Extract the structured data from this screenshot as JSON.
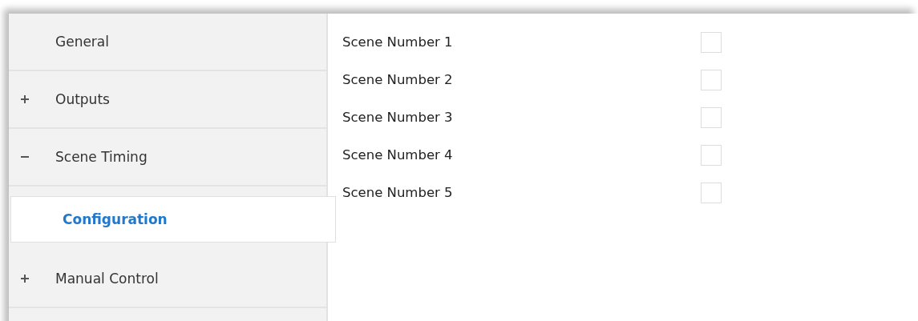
{
  "sidebar": {
    "items": [
      {
        "kind": "page",
        "label": "General",
        "selected": false
      },
      {
        "kind": "group",
        "label": "Outputs",
        "expanded": false,
        "selected": false
      },
      {
        "kind": "group",
        "label": "Scene Timing",
        "expanded": true,
        "selected": false,
        "children": [
          {
            "label": "Configuration",
            "selected": true
          }
        ]
      },
      {
        "kind": "group",
        "label": "Manual Control",
        "expanded": false,
        "selected": false
      }
    ]
  },
  "scenes": [
    {
      "label": "Scene Number 1",
      "checked": false
    },
    {
      "label": "Scene Number 2",
      "checked": false
    },
    {
      "label": "Scene Number 3",
      "checked": false
    },
    {
      "label": "Scene Number 4",
      "checked": false
    },
    {
      "label": "Scene Number 5",
      "checked": false
    }
  ]
}
